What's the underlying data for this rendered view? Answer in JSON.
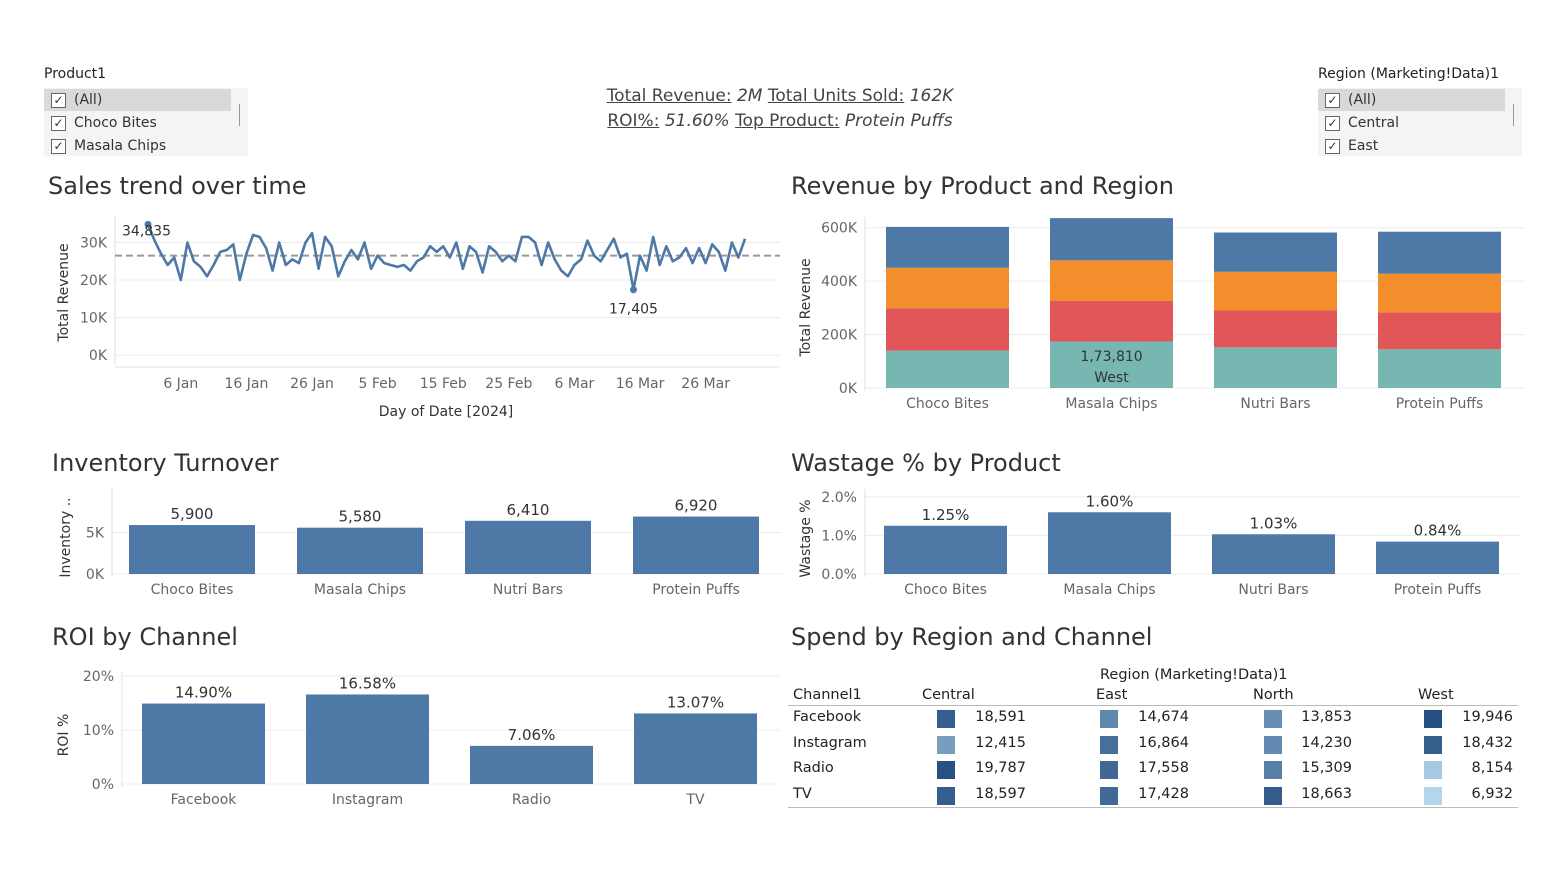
{
  "filters": {
    "product": {
      "title": "Product1",
      "items": [
        {
          "label": "(All)",
          "checked": true,
          "selected": true
        },
        {
          "label": "Choco Bites",
          "checked": true,
          "selected": false
        },
        {
          "label": "Masala Chips",
          "checked": true,
          "selected": false
        }
      ]
    },
    "region": {
      "title": "Region (Marketing!Data)1",
      "items": [
        {
          "label": "(All)",
          "checked": true,
          "selected": true
        },
        {
          "label": "Central",
          "checked": true,
          "selected": false
        },
        {
          "label": "East",
          "checked": true,
          "selected": false
        }
      ]
    }
  },
  "kpi": {
    "total_revenue_label": "Total Revenue:",
    "total_revenue_value": "2M",
    "total_units_label": "Total Units Sold:",
    "total_units_value": "162K",
    "roi_label": "ROI%:",
    "roi_value": "51.60%",
    "top_product_label": "Top Product:",
    "top_product_value": "Protein Puffs"
  },
  "titles": {
    "sales_trend": "Sales trend over time",
    "revenue_product_region": "Revenue by Product and Region",
    "inventory_turnover": "Inventory Turnover",
    "wastage": "Wastage % by Product",
    "roi_channel": "ROI by Channel",
    "spend_region_channel": "Spend by Region and Channel"
  },
  "colors": {
    "bar_blue": "#4e79a7",
    "west": "#4e79a7",
    "north": "#f28e2b",
    "east": "#e15759",
    "central": "#76b7b2",
    "avg_line": "#999999"
  },
  "chart_data": [
    {
      "id": "sales_trend",
      "type": "line",
      "xlabel": "Day of Date [2024]",
      "ylabel": "Total Revenue",
      "x_ticks": [
        "6 Jan",
        "16 Jan",
        "26 Jan",
        "5 Feb",
        "15 Feb",
        "25 Feb",
        "6 Mar",
        "16 Mar",
        "26 Mar"
      ],
      "y_ticks": [
        "0K",
        "10K",
        "20K",
        "30K"
      ],
      "ylim": [
        0,
        36000
      ],
      "x_start": "2024-01-01",
      "reference_line": {
        "type": "average",
        "value": 26500
      },
      "annotations": [
        {
          "label": "34,835",
          "date": "2024-01-06",
          "value": 34835
        },
        {
          "label": "17,405",
          "date": "2024-03-16",
          "value": 17405
        }
      ],
      "series": [
        {
          "values": [
            34835,
            30500,
            27000,
            24000,
            26000,
            20000,
            30000,
            25000,
            23500,
            21000,
            24000,
            27500,
            28000,
            29500,
            20000,
            27000,
            32000,
            31500,
            28500,
            22500,
            30000,
            24000,
            25500,
            24500,
            30000,
            32500,
            23000,
            31500,
            29000,
            21000,
            25000,
            28000,
            25500,
            30000,
            23000,
            26500,
            24500,
            24000,
            23500,
            24000,
            22500,
            25000,
            26000,
            29000,
            27500,
            29000,
            26000,
            30000,
            23000,
            29000,
            27500,
            22000,
            29000,
            27500,
            25000,
            26500,
            25000,
            31500,
            31500,
            30000,
            24000,
            30000,
            25500,
            22500,
            21000,
            24000,
            25500,
            30500,
            26500,
            25000,
            28000,
            31000,
            26000,
            27000,
            17405,
            26500,
            22500,
            31500,
            24000,
            29000,
            25000,
            26000,
            28500,
            24500,
            28500,
            24500,
            29500,
            27500,
            22500,
            30000,
            26000,
            31000
          ]
        }
      ]
    },
    {
      "id": "revenue_product_region",
      "type": "bar",
      "stacked": true,
      "ylabel": "Total Revenue",
      "y_ticks": [
        "0K",
        "200K",
        "400K",
        "600K"
      ],
      "ylim": [
        0,
        640000
      ],
      "categories": [
        "Choco Bites",
        "Masala Chips",
        "Nutri Bars",
        "Protein Puffs"
      ],
      "series": [
        {
          "name": "Central",
          "values": [
            140000,
            173810,
            152000,
            145000
          ]
        },
        {
          "name": "East",
          "values": [
            158000,
            152000,
            138000,
            138000
          ]
        },
        {
          "name": "North",
          "values": [
            152000,
            152000,
            145000,
            145000
          ]
        },
        {
          "name": "West",
          "values": [
            153000,
            158000,
            147000,
            157000
          ]
        }
      ],
      "annotation": {
        "category": "Masala Chips",
        "value_label": "1,73,810",
        "series_label": "West"
      }
    },
    {
      "id": "inventory_turnover",
      "type": "bar",
      "ylabel": "Inventory ..",
      "y_ticks": [
        "0K",
        "5K"
      ],
      "ylim": [
        0,
        10000
      ],
      "categories": [
        "Choco Bites",
        "Masala Chips",
        "Nutri Bars",
        "Protein Puffs"
      ],
      "values": [
        5900,
        5580,
        6410,
        6920
      ],
      "labels": [
        "5,900",
        "5,580",
        "6,410",
        "6,920"
      ]
    },
    {
      "id": "wastage",
      "type": "bar",
      "ylabel": "Wastage %",
      "y_ticks": [
        "0.0%",
        "1.0%",
        "2.0%"
      ],
      "ylim": [
        0,
        2.1
      ],
      "categories": [
        "Choco Bites",
        "Masala Chips",
        "Nutri Bars",
        "Protein Puffs"
      ],
      "values": [
        1.25,
        1.6,
        1.03,
        0.84
      ],
      "labels": [
        "1.25%",
        "1.60%",
        "1.03%",
        "0.84%"
      ]
    },
    {
      "id": "roi_channel",
      "type": "bar",
      "ylabel": "ROI %",
      "y_ticks": [
        "0%",
        "10%",
        "20%"
      ],
      "ylim": [
        0,
        20
      ],
      "categories": [
        "Facebook",
        "Instagram",
        "Radio",
        "TV"
      ],
      "values": [
        14.9,
        16.58,
        7.06,
        13.07
      ],
      "labels": [
        "14.90%",
        "16.58%",
        "7.06%",
        "13.07%"
      ]
    },
    {
      "id": "spend_region_channel",
      "type": "table",
      "column_group_label": "Region (Marketing!Data)1",
      "row_header_label": "Channel1",
      "columns": [
        "Central",
        "East",
        "North",
        "West"
      ],
      "rows": [
        {
          "channel": "Facebook",
          "values": [
            18591,
            14674,
            13853,
            19946
          ],
          "labels": [
            "18,591",
            "14,674",
            "13,853",
            "19,946"
          ]
        },
        {
          "channel": "Instagram",
          "values": [
            12415,
            16864,
            14230,
            18432
          ],
          "labels": [
            "12,415",
            "16,864",
            "14,230",
            "18,432"
          ]
        },
        {
          "channel": "Radio",
          "values": [
            19787,
            17558,
            15309,
            8154
          ],
          "labels": [
            "19,787",
            "17,558",
            "15,309",
            "8,154"
          ]
        },
        {
          "channel": "TV",
          "values": [
            18597,
            17428,
            18663,
            6932
          ],
          "labels": [
            "18,597",
            "17,428",
            "18,663",
            "6,932"
          ]
        }
      ]
    }
  ]
}
